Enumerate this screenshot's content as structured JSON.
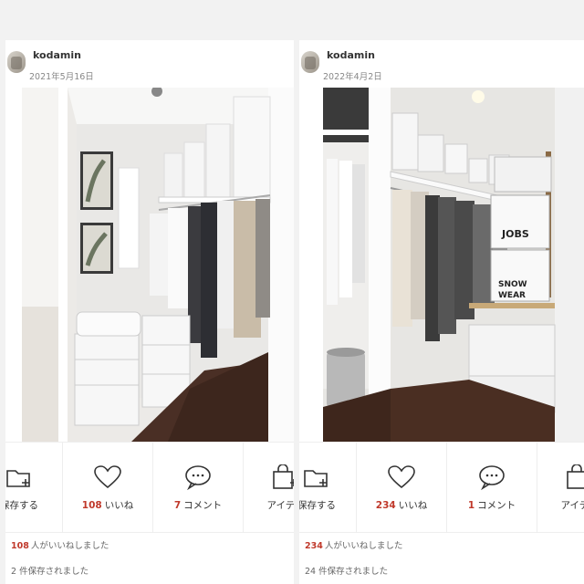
{
  "posts": [
    {
      "username": "kodamin",
      "date": "2021年5月16日",
      "actions": {
        "save_label": "保存する",
        "like_count": "108",
        "like_label": "いいね",
        "comment_count": "7",
        "comment_label": "コメント",
        "item_label": "アイテム"
      },
      "stats": {
        "likes_count": "108",
        "likes_suffix": "人がいいねしました",
        "saved_text": "2 件保存されました"
      }
    },
    {
      "username": "kodamin",
      "date": "2022年4月2日",
      "photo_box_labels": [
        "JOBS",
        "SNOW",
        "WEAR"
      ],
      "actions": {
        "save_label": "保存する",
        "like_count": "234",
        "like_label": "いいね",
        "comment_count": "1",
        "comment_label": "コメント",
        "item_label": "アイテム"
      },
      "stats": {
        "likes_count": "234",
        "likes_suffix": "人がいいねしました",
        "saved_text": "24 件保存されました"
      }
    }
  ],
  "icons": [
    "avatar",
    "folder-plus-icon",
    "heart-icon",
    "comment-bubble-icon",
    "shopping-bag-plus-icon"
  ],
  "colors": {
    "count_red": "#c0392b",
    "text": "#333333",
    "muted": "#888888"
  }
}
